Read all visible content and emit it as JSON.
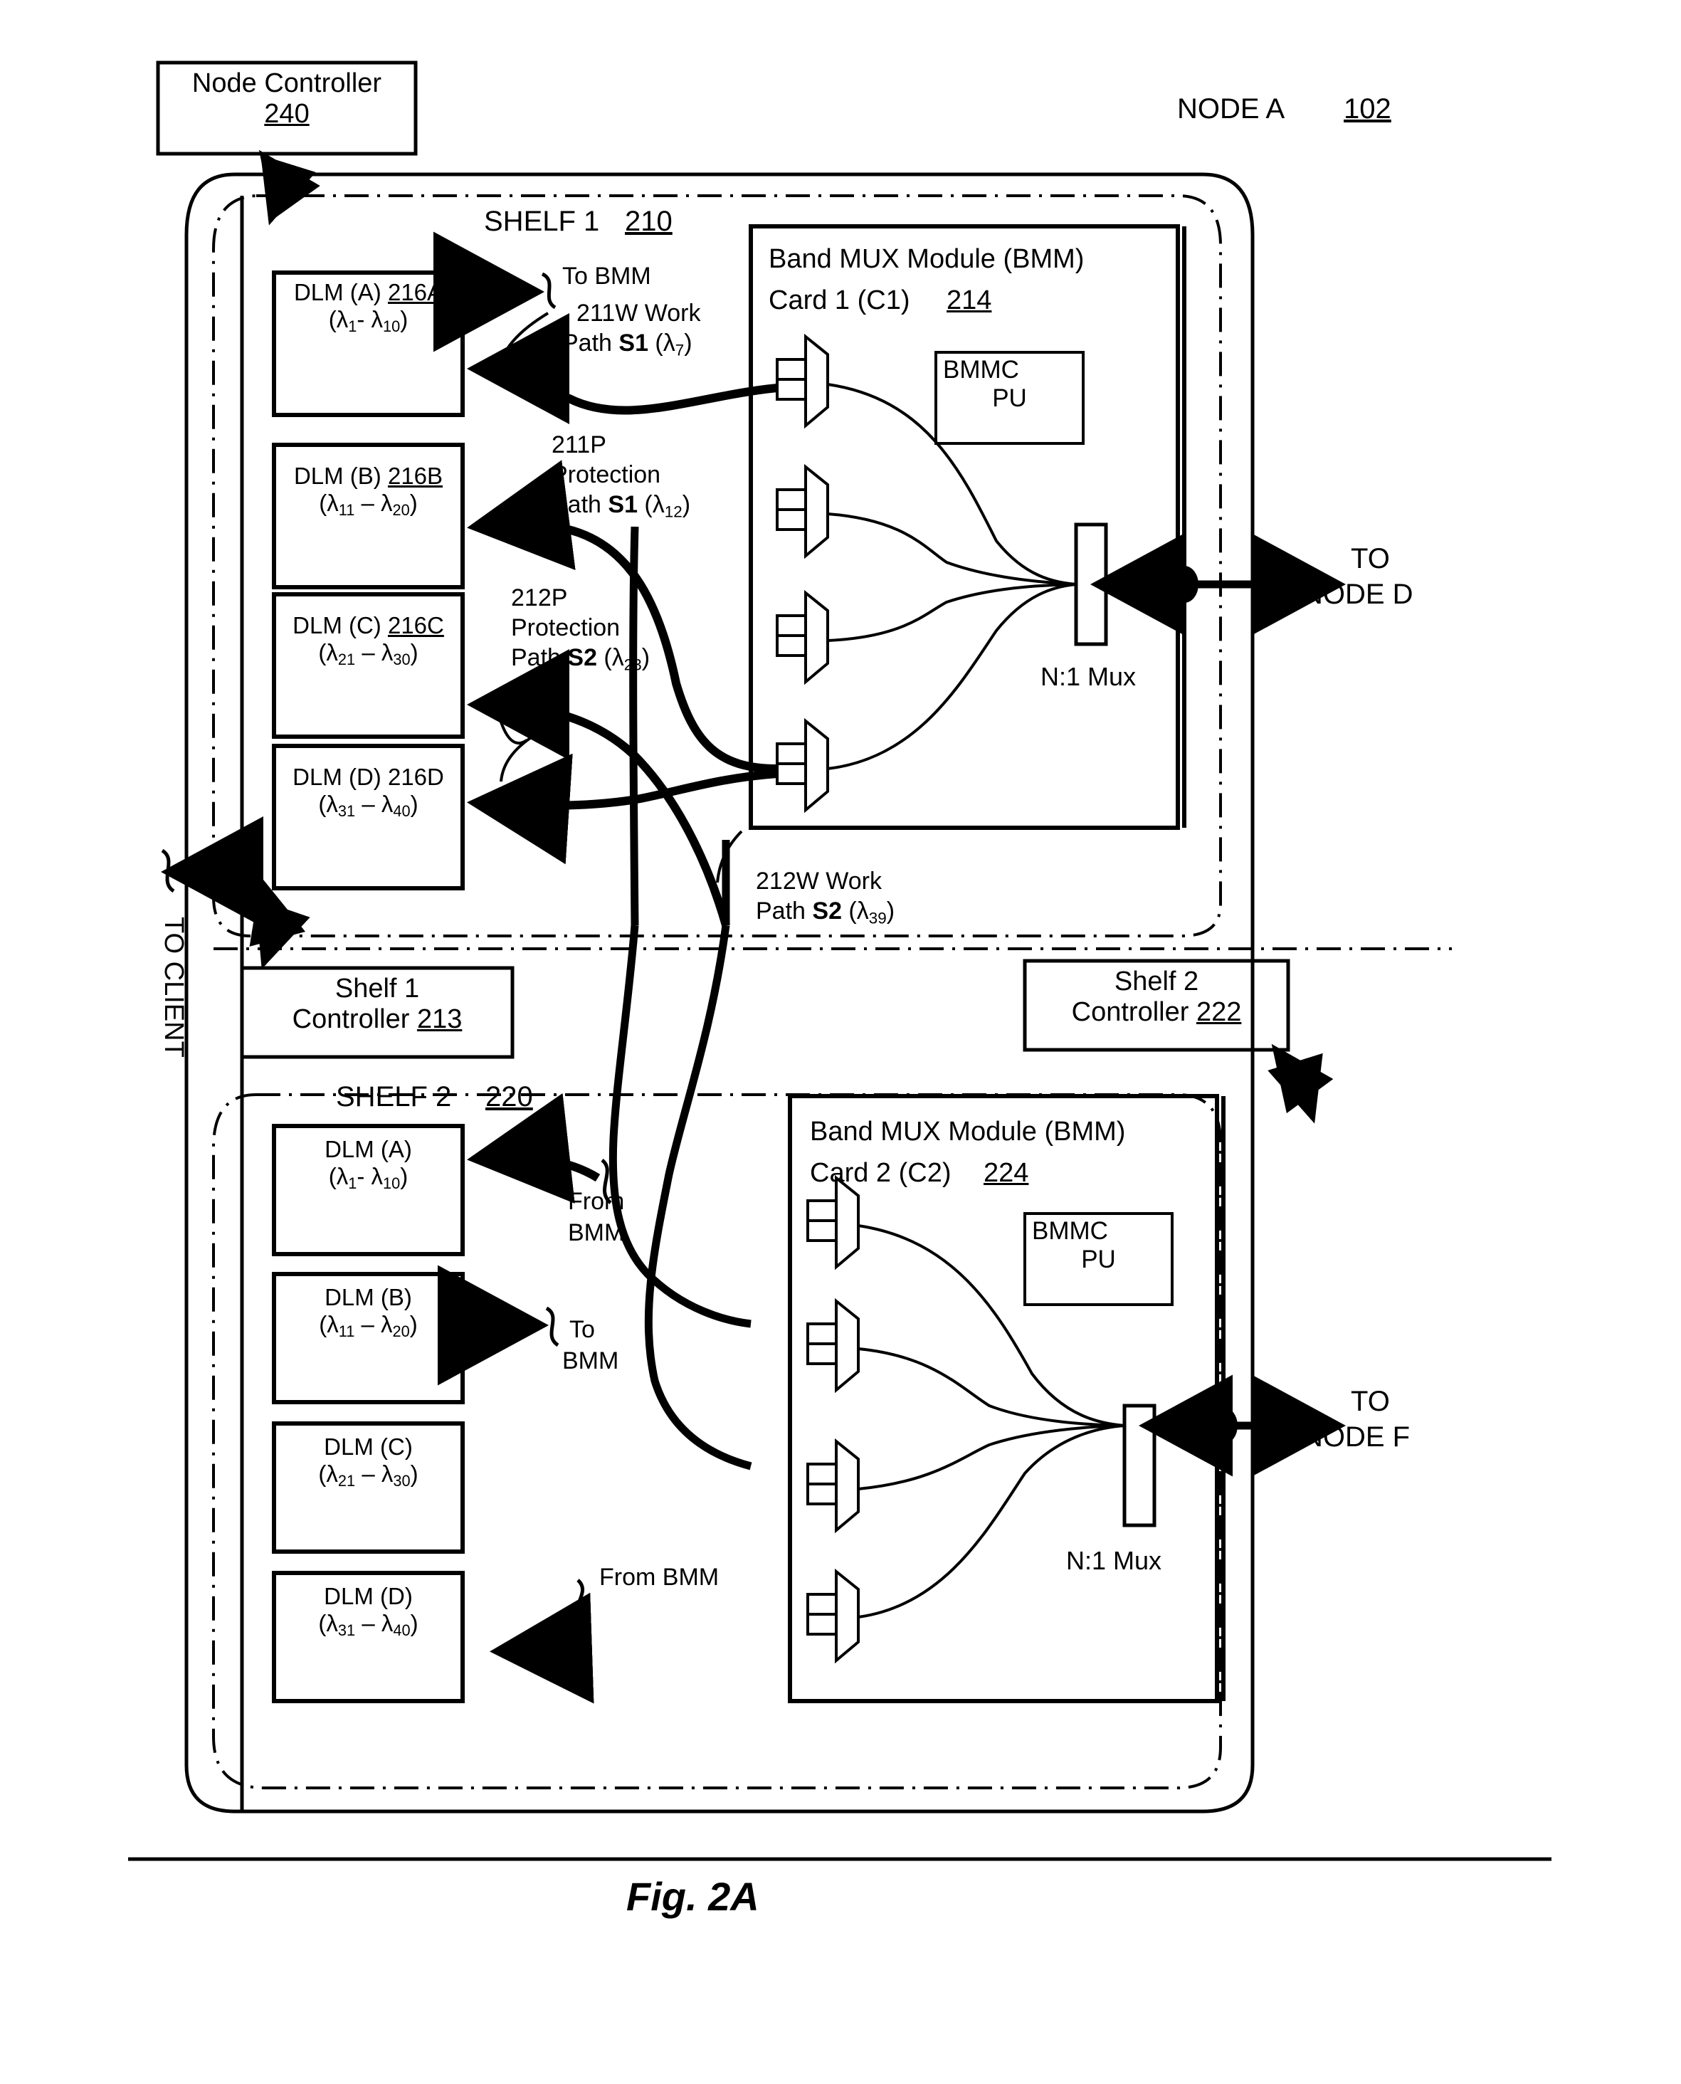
{
  "figure": {
    "caption": "Fig. 2A",
    "node_label": "NODE A",
    "node_ref": "102"
  },
  "node_controller": {
    "title": "Node  Controller",
    "ref": "240"
  },
  "client_label": "TO CLIENT",
  "shelf1": {
    "title": "SHELF 1",
    "ref": "210",
    "controller": {
      "line1": "Shelf  1",
      "line2_text": "Controller ",
      "line2_ref": "213"
    },
    "dlms": [
      {
        "name": "DLM (A)",
        "ref": "216A",
        "ref_underlined": true,
        "range_pre": "(λ",
        "range": "(λ1 - λ10)",
        "lo": "1",
        "hi": "10",
        "dash": "-"
      },
      {
        "name": "DLM (B)",
        "ref": "216B",
        "ref_underlined": true,
        "range": "(λ11 – λ20)",
        "lo": "11",
        "hi": "20",
        "dash": "–"
      },
      {
        "name": "DLM (C)",
        "ref": "216C",
        "ref_underlined": true,
        "range": "(λ21 – λ30)",
        "lo": "21",
        "hi": "30",
        "dash": "–"
      },
      {
        "name": "DLM (D)",
        "ref": "216D",
        "ref_underlined": false,
        "range": "(λ31 – λ40)",
        "lo": "31",
        "hi": "40",
        "dash": "–"
      }
    ],
    "bmm": {
      "line1": "Band MUX Module (BMM)",
      "line2_text": "Card 1 (C1)",
      "ref": "214",
      "bmmc_line1": "BMMC",
      "bmmc_line2": "PU",
      "mux_label": "N:1 Mux"
    },
    "annotations": {
      "to_bmm": "To BMM",
      "work_211w_l1": "211W Work",
      "work_211w_l2_pre": "Path ",
      "work_211w_l2_bold": "S1",
      "work_211w_l2_post": " (λ7)",
      "prot_211p_l1": "211P",
      "prot_211p_l2": "Protection",
      "prot_211p_l3_pre": "Path ",
      "prot_211p_l3_bold": "S1",
      "prot_211p_l3_post": " (λ12)",
      "prot_212p_l1": "212P",
      "prot_212p_l2": "Protection",
      "prot_212p_l3_pre": "Path ",
      "prot_212p_l3_bold": "S2",
      "prot_212p_l3_post": " (λ23)",
      "work_212w_l1": "212W Work",
      "work_212w_l2_pre": "Path ",
      "work_212w_l2_bold": "S2",
      "work_212w_l2_post": " (λ39)"
    },
    "egress": "TO\nNODE D",
    "egress_l1": "TO",
    "egress_l2": "NODE D"
  },
  "shelf2": {
    "title": "SHELF 2",
    "ref": "220",
    "controller": {
      "line1": "Shelf  2",
      "line2_text": "Controller ",
      "line2_ref": "222"
    },
    "dlms": [
      {
        "name": "DLM (A)",
        "range": "(λ1 - λ10)",
        "lo": "1",
        "hi": "10",
        "dash": "-"
      },
      {
        "name": "DLM (B)",
        "range": "(λ11 – λ20)",
        "lo": "11",
        "hi": "20",
        "dash": "–"
      },
      {
        "name": "DLM (C)",
        "range": "(λ21 – λ30)",
        "lo": "21",
        "hi": "30",
        "dash": "–"
      },
      {
        "name": "DLM (D)",
        "range": "(λ31 – λ40)",
        "lo": "31",
        "hi": "40",
        "dash": "–"
      }
    ],
    "bmm": {
      "line1": "Band MUX Module (BMM)",
      "line2_text": "Card 2 (C2)",
      "ref": "224",
      "bmmc_line1": "BMMC",
      "bmmc_line2": "PU",
      "mux_label": "N:1 Mux"
    },
    "annotations": {
      "from_bmm_a_l1": "From",
      "from_bmm_a_l2": "BMM",
      "to_bmm_b_l1": "To",
      "to_bmm_b_l2": "BMM",
      "from_bmm_d": "From BMM"
    },
    "egress_l1": "TO",
    "egress_l2": "NODE F"
  }
}
